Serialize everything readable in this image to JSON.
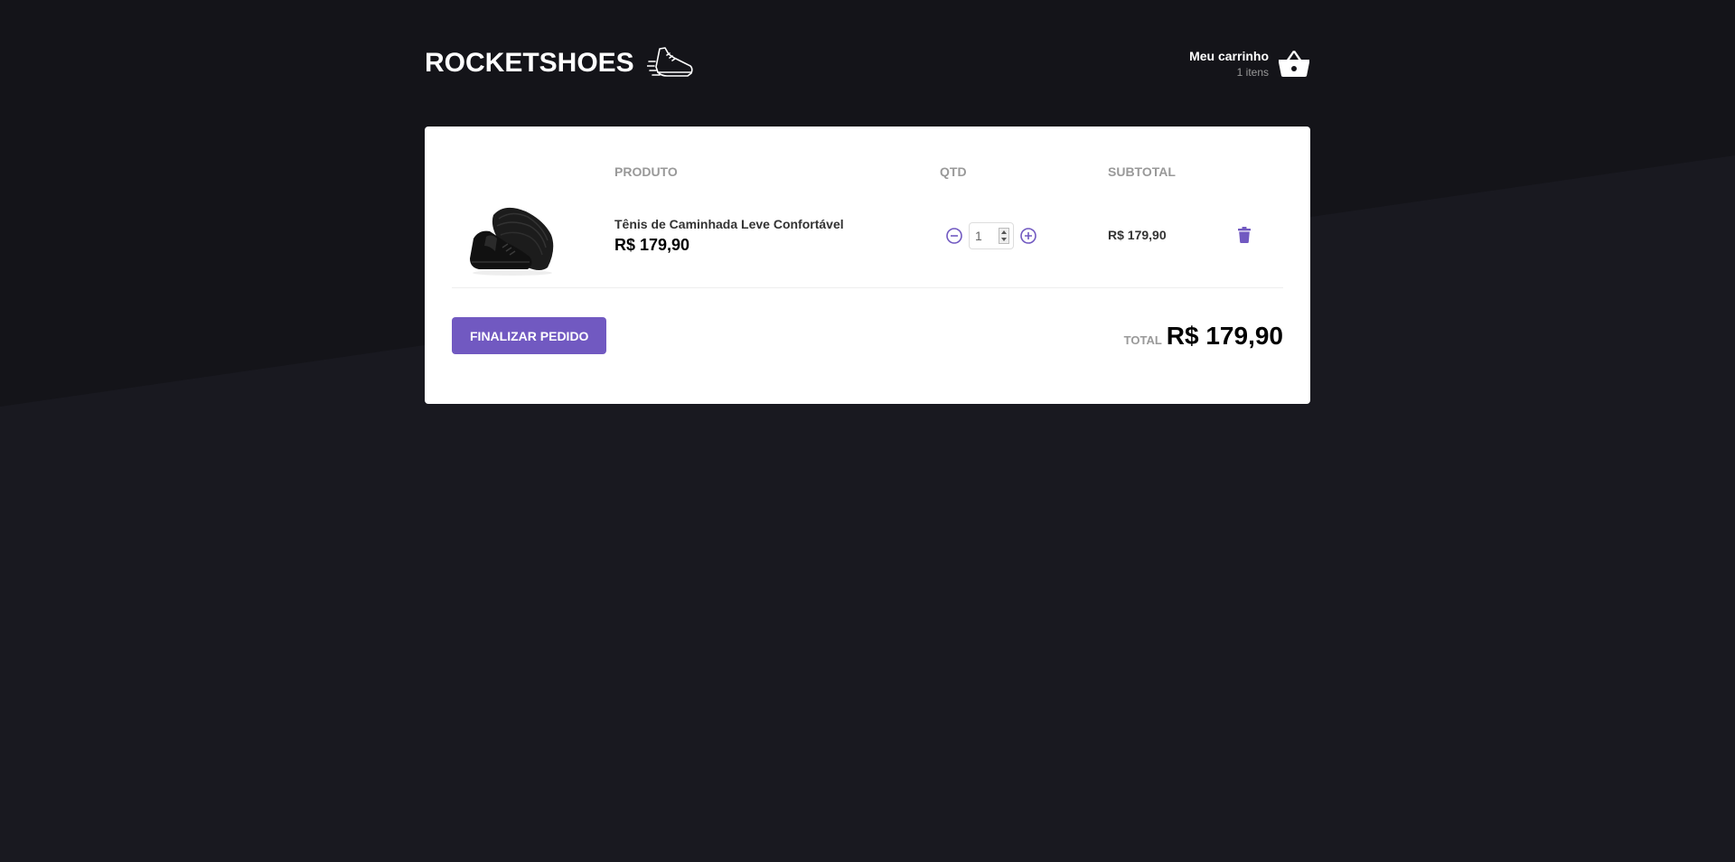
{
  "header": {
    "logo": "ROCKETSHOES",
    "cart_title": "Meu carrinho",
    "cart_count": "1 itens"
  },
  "table": {
    "columns": [
      "",
      "PRODUTO",
      "QTD",
      "SUBTOTAL",
      ""
    ],
    "rows": [
      {
        "name": "Tênis de Caminhada Leve Confortável",
        "price": "R$ 179,90",
        "quantity": "1",
        "subtotal": "R$ 179,90"
      }
    ]
  },
  "footer": {
    "finish_label": "FINALIZAR PEDIDO",
    "total_label": "TOTAL",
    "total_value": "R$ 179,90"
  },
  "icons": {
    "shoe": "shoe-icon",
    "cart": "basket-icon",
    "decrement": "minus-circle-icon",
    "increment": "plus-circle-icon",
    "delete": "trash-icon"
  },
  "colors": {
    "accent": "#7159c1",
    "background": "#191920",
    "card": "#ffffff"
  }
}
